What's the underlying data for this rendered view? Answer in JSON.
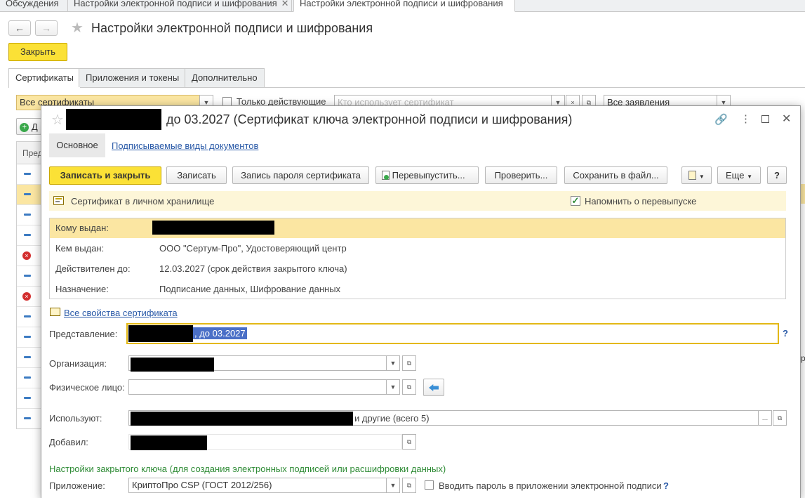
{
  "window_tabs": [
    {
      "label": "Обсуждения"
    },
    {
      "label": "Настройки электронной подписи и шифрования"
    },
    {
      "label": "Настройки электронной подписи и шифрования"
    }
  ],
  "main": {
    "title": "Настройки электронной подписи и шифрования",
    "close_label": "Закрыть",
    "tabs": [
      {
        "label": "Сертификаты"
      },
      {
        "label": "Приложения и токены"
      },
      {
        "label": "Дополнительно"
      }
    ],
    "filter_all": "Все сертификаты",
    "only_active": "Только действующие",
    "used_by_placeholder": "Кто использует сертификат",
    "statements": "Все заявления",
    "list_header": "Пред",
    "add_label": "Д",
    "right_frag": "р"
  },
  "dialog": {
    "title_suffix": "до 03.2027 (Сертификат ключа электронной подписи и шифрования)",
    "tabs": [
      {
        "label": "Основное"
      },
      {
        "label": "Подписываемые виды документов"
      }
    ],
    "buttons": {
      "save_close": "Записать и закрыть",
      "save": "Записать",
      "password": "Запись пароля сертификата",
      "reissue": "Перевыпустить...",
      "check": "Проверить...",
      "save_file": "Сохранить в файл...",
      "more": "Еще",
      "help": "?"
    },
    "store_label": "Сертификат в личном хранилище",
    "remind_label": "Напомнить о перевыпуске",
    "remind_checked": true,
    "info": {
      "issued_to_label": "Кому выдан:",
      "issued_by_label": "Кем выдан:",
      "issued_by_value": "ООО \"Сертум-Про\", Удостоверяющий центр",
      "valid_label": "Действителен до:",
      "valid_value": "12.03.2027 (срок действия закрытого ключа)",
      "purpose_label": "Назначение:",
      "purpose_value": "Подписание данных, Шифрование данных"
    },
    "all_props_link": "Все свойства сертификата",
    "presentation_label": "Представление:",
    "presentation_value": ", до 03.2027",
    "org_label": "Организация:",
    "person_label": "Физическое лицо:",
    "users_label": "Используют:",
    "users_suffix": "и другие (всего 5)",
    "added_label": "Добавил:",
    "key_section": "Настройки закрытого ключа (для создания электронных подписей или расшифровки данных)",
    "app_label": "Приложение:",
    "app_value": "КриптоПро CSP (ГОСТ 2012/256)",
    "enter_password_label": "Вводить пароль в приложении электронной подписи",
    "q": "?"
  }
}
